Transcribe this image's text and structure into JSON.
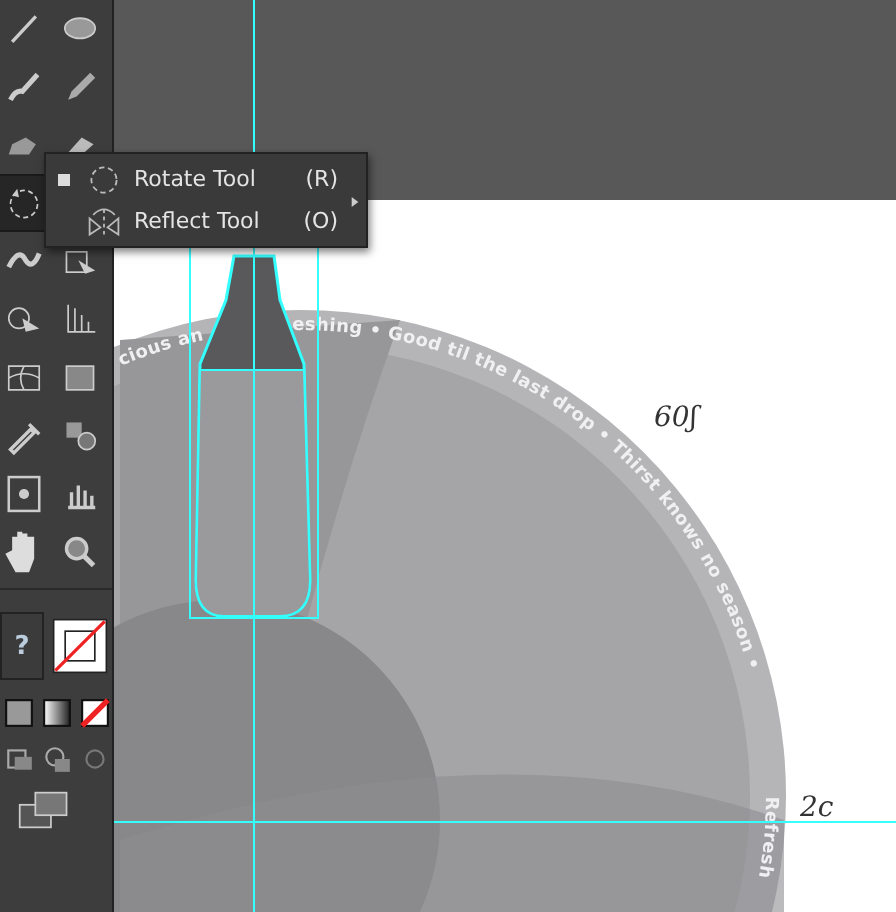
{
  "toolbar": {
    "tools": [
      {
        "selected": false
      },
      {
        "selected": false
      },
      {
        "selected": false
      },
      {
        "selected": false
      },
      {
        "selected": false
      },
      {
        "selected": false
      },
      {
        "selected": true
      },
      {
        "selected": false
      },
      {
        "selected": false
      },
      {
        "selected": false
      },
      {
        "selected": false
      },
      {
        "selected": false
      },
      {
        "selected": false
      },
      {
        "selected": false
      },
      {
        "selected": false
      },
      {
        "selected": false
      },
      {
        "selected": false
      },
      {
        "selected": false
      },
      {
        "selected": false
      }
    ],
    "help_badge": "?"
  },
  "flyout": {
    "items": [
      {
        "label": "Rotate Tool",
        "shortcut": "(R)",
        "selected": true
      },
      {
        "label": "Reflect Tool",
        "shortcut": "(O)",
        "selected": false
      }
    ]
  },
  "canvas": {
    "ring_text": [
      {
        "text": "cious an"
      },
      {
        "text": "eshing • Good til the last drop • Thirst knows no season •"
      },
      {
        "text": "Refresh"
      }
    ],
    "notes": [
      {
        "text": "60ʃ"
      },
      {
        "text": "2c"
      }
    ]
  }
}
